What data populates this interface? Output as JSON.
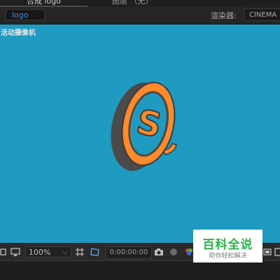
{
  "top_tabs": [
    {
      "label": "合成 logo",
      "active": true
    },
    {
      "label": "图层 （无）",
      "active": false
    }
  ],
  "composition_tab": {
    "label": "logo"
  },
  "renderer": {
    "label": "渲染器:",
    "value": "CINEMA"
  },
  "viewer": {
    "camera_label": "活动摄像机",
    "background_color": "#1f9ac0",
    "logo": {
      "letter": "S",
      "ring_color": "#ff8a2a",
      "side_color": "#4a4a4a"
    }
  },
  "bottom_toolbar": {
    "zoom": "100%",
    "timecode": "0:00:00:00"
  },
  "watermark": {
    "title": "百科全说",
    "subtitle": "助你轻松解决"
  }
}
